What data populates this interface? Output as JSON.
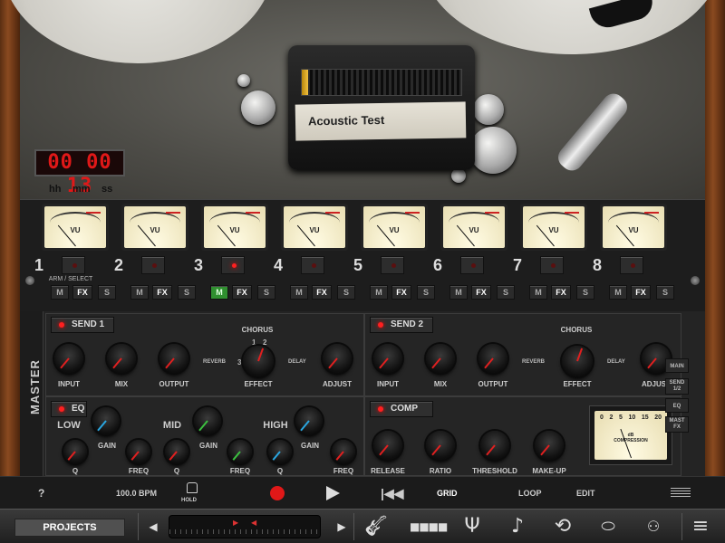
{
  "deck": {
    "tape_label": "Acoustic Test",
    "input_level": 0.04,
    "counter": "00 00 13",
    "counter_units": [
      "hh",
      "mm",
      "ss"
    ]
  },
  "tracks": [
    {
      "number": "1",
      "armed": false,
      "monitor": false,
      "sub_label": "ARM / SELECT"
    },
    {
      "number": "2",
      "armed": false,
      "monitor": false
    },
    {
      "number": "3",
      "armed": true,
      "monitor": true
    },
    {
      "number": "4",
      "armed": false,
      "monitor": false
    },
    {
      "number": "5",
      "armed": false,
      "monitor": false
    },
    {
      "number": "6",
      "armed": false,
      "monitor": false
    },
    {
      "number": "7",
      "armed": false,
      "monitor": false
    },
    {
      "number": "8",
      "armed": false,
      "monitor": false
    }
  ],
  "track_buttons": {
    "m": "M",
    "fx": "FX",
    "s": "S"
  },
  "vu_label": "VU",
  "master": {
    "label": "MASTER",
    "send1": {
      "button": "SEND 1",
      "input": "INPUT",
      "mix": "MIX",
      "output": "OUTPUT",
      "effect": "EFFECT",
      "adjust": "ADJUST",
      "chorus": "CHORUS",
      "reverb": "REVERB",
      "delay": "DELAY"
    },
    "send2": {
      "button": "SEND 2",
      "input": "INPUT",
      "mix": "MIX",
      "output": "OUTPUT",
      "effect": "EFFECT",
      "adjust": "ADJUST",
      "chorus": "CHORUS",
      "reverb": "REVERB",
      "delay": "DELAY"
    },
    "effect_positions": [
      "1",
      "2",
      "3",
      "2",
      "3",
      "1",
      "2",
      "3"
    ],
    "eq": {
      "button": "EQ",
      "low": "LOW",
      "mid": "MID",
      "high": "HIGH",
      "gain": "GAIN",
      "q": "Q",
      "freq": "FREQ"
    },
    "comp": {
      "button": "COMP",
      "release": "RELEASE",
      "ratio": "RATIO",
      "threshold": "THRESHOLD",
      "makeup": "MAKE-UP",
      "meter_title": "COMPRESSION",
      "meter_unit": "dB",
      "meter_ticks": [
        "0",
        "2",
        "5",
        "10",
        "15",
        "20"
      ]
    },
    "route_buttons": [
      "MAIN",
      "SEND 1/2",
      "EQ",
      "MAST FX"
    ]
  },
  "transport": {
    "help": "?",
    "bpm": "100.0 BPM",
    "hold": "HOLD",
    "grid": "GRID",
    "loop": "LOOP",
    "edit": "EDIT"
  },
  "bottom": {
    "projects": "PROJECTS",
    "icons": [
      "guitar-icon",
      "pads-icon",
      "tuner-icon",
      "note-icon",
      "loop-icon",
      "drum-icon",
      "tape-deck-icon",
      "menu-icon"
    ]
  },
  "colors": {
    "led_red": "#ff2020",
    "monitor_green": "#2f8f2f",
    "counter_red": "#e01818"
  }
}
